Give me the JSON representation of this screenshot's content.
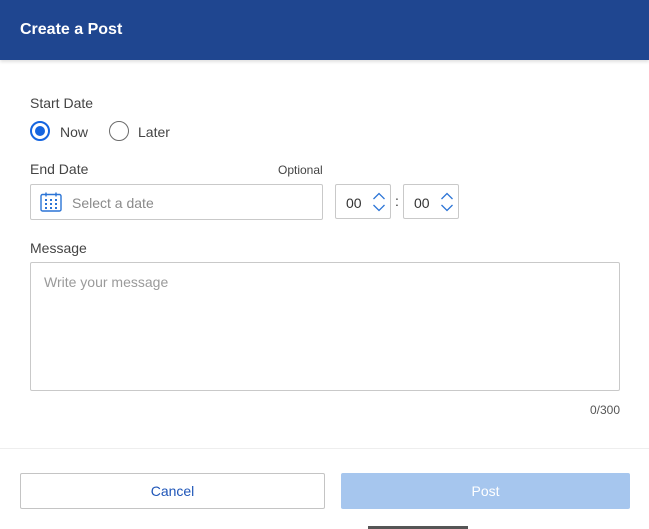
{
  "header": {
    "title": "Create a Post"
  },
  "start_date": {
    "label": "Start Date",
    "options": [
      {
        "label": "Now",
        "selected": true
      },
      {
        "label": "Later",
        "selected": false
      }
    ]
  },
  "end_date": {
    "label": "End Date",
    "optional_label": "Optional",
    "date_placeholder": "Select a date",
    "hours": "00",
    "separator": ":",
    "minutes": "00"
  },
  "message": {
    "label": "Message",
    "placeholder": "Write your message",
    "counter": "0/300"
  },
  "footer": {
    "cancel_label": "Cancel",
    "post_label": "Post"
  },
  "colors": {
    "header_bg": "#1f4690",
    "accent": "#1565e0",
    "post_disabled": "#a6c6ee"
  },
  "icons": {
    "calendar": "calendar-icon",
    "stepper": "chevron-up-down-icon"
  }
}
